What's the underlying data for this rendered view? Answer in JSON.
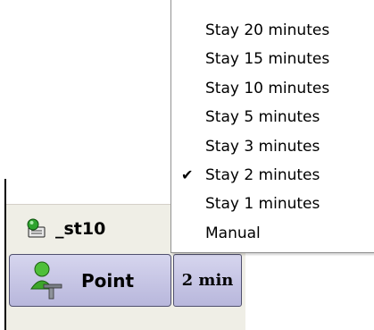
{
  "station": {
    "label": "_st10",
    "icon": "computer-station-icon"
  },
  "point_button": {
    "label": "Point",
    "icon": "user-pointer-icon"
  },
  "time_button": {
    "label": "2 min"
  },
  "menu": {
    "items": [
      {
        "label": "Stay 20 minutes",
        "checked": false
      },
      {
        "label": "Stay 15 minutes",
        "checked": false
      },
      {
        "label": "Stay 10 minutes",
        "checked": false
      },
      {
        "label": "Stay 5 minutes",
        "checked": false
      },
      {
        "label": "Stay 3 minutes",
        "checked": false
      },
      {
        "label": "Stay 2 minutes",
        "checked": true
      },
      {
        "label": "Stay 1 minutes",
        "checked": false
      },
      {
        "label": "Manual",
        "checked": false
      }
    ],
    "check_glyph": "✔"
  }
}
